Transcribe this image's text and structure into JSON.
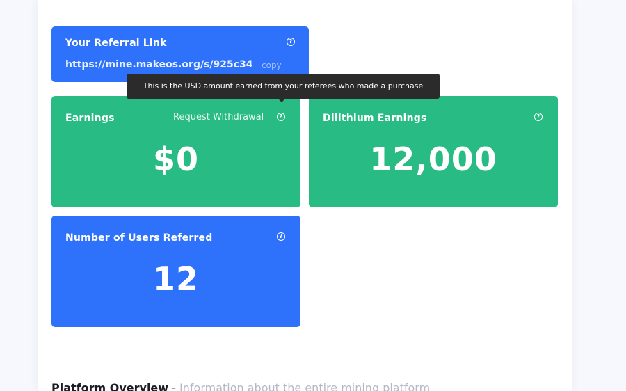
{
  "top_cut_text": "",
  "referral": {
    "title": "Your Referral Link",
    "url": "https://mine.makeos.org/s/925c34",
    "copy_label": "copy"
  },
  "tooltip": {
    "text": "This is the USD amount earned from your referees who made a purchase"
  },
  "earnings": {
    "title": "Earnings",
    "withdraw_label": "Request Withdrawal",
    "value": "$0"
  },
  "dilithium": {
    "title": "Dilithium Earnings",
    "value": "12,000"
  },
  "users_referred": {
    "title": "Number of Users Referred",
    "value": "12"
  },
  "platform_overview": {
    "title": "Platform Overview",
    "separator": "-",
    "subtitle": "Information about the entire mining platform"
  },
  "colors": {
    "blue_card": "#2e72fb",
    "green_card": "#28bb84",
    "tooltip_bg": "#2b2b2b"
  },
  "icons": {
    "help": "question-circle-icon"
  }
}
